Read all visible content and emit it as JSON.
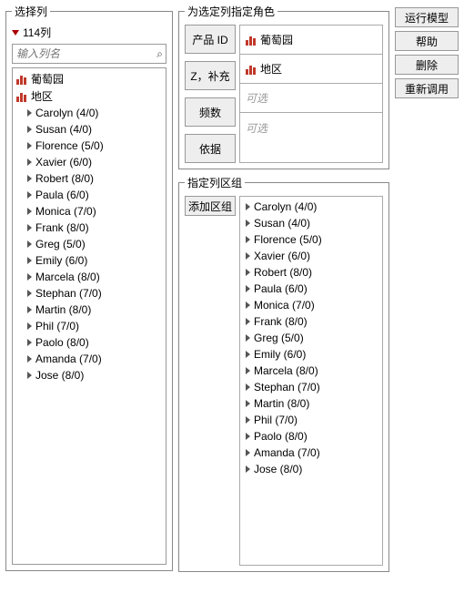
{
  "left": {
    "title": "选择列",
    "count_label": "114列",
    "search_placeholder": "输入列名",
    "groups": [
      {
        "name": "葡萄园"
      },
      {
        "name": "地区"
      }
    ],
    "items": [
      {
        "label": "Carolyn (4/0)"
      },
      {
        "label": "Susan (4/0)"
      },
      {
        "label": "Florence (5/0)"
      },
      {
        "label": "Xavier (6/0)"
      },
      {
        "label": "Robert (8/0)"
      },
      {
        "label": "Paula (6/0)"
      },
      {
        "label": "Monica (7/0)"
      },
      {
        "label": "Frank (8/0)"
      },
      {
        "label": "Greg (5/0)"
      },
      {
        "label": "Emily (6/0)"
      },
      {
        "label": "Marcela (8/0)"
      },
      {
        "label": "Stephan (7/0)"
      },
      {
        "label": "Martin (8/0)"
      },
      {
        "label": "Phil (7/0)"
      },
      {
        "label": "Paolo (8/0)"
      },
      {
        "label": "Amanda (7/0)"
      },
      {
        "label": "Jose (8/0)"
      }
    ]
  },
  "roles": {
    "title": "为选定列指定角色",
    "buttons": {
      "product_id": "产品 ID",
      "z_supp": "Z，补充",
      "freq": "频数",
      "by": "依据"
    },
    "slots": {
      "product_id": "葡萄园",
      "z_supp": "地区",
      "freq_placeholder": "可选",
      "by_placeholder": "可选"
    }
  },
  "group": {
    "title": "指定列区组",
    "add_button": "添加区组",
    "items": [
      {
        "label": "Carolyn (4/0)"
      },
      {
        "label": "Susan (4/0)"
      },
      {
        "label": "Florence (5/0)"
      },
      {
        "label": "Xavier (6/0)"
      },
      {
        "label": "Robert (8/0)"
      },
      {
        "label": "Paula (6/0)"
      },
      {
        "label": "Monica (7/0)"
      },
      {
        "label": "Frank (8/0)"
      },
      {
        "label": "Greg (5/0)"
      },
      {
        "label": "Emily (6/0)"
      },
      {
        "label": "Marcela (8/0)"
      },
      {
        "label": "Stephan (7/0)"
      },
      {
        "label": "Martin (8/0)"
      },
      {
        "label": "Phil (7/0)"
      },
      {
        "label": "Paolo (8/0)"
      },
      {
        "label": "Amanda (7/0)"
      },
      {
        "label": "Jose (8/0)"
      }
    ]
  },
  "actions": {
    "run": "运行模型",
    "help": "帮助",
    "delete": "删除",
    "recall": "重新调用"
  }
}
